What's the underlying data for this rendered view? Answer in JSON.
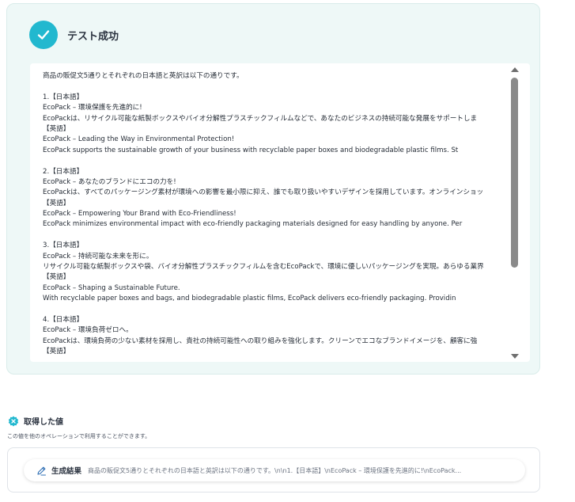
{
  "success": {
    "title": "テスト成功"
  },
  "output": {
    "lines": [
      "商品の販促文5通りとそれぞれの日本語と英訳は以下の通りです。",
      "",
      "1.【日本語】",
      "EcoPack – 環境保護を先進的に!",
      "EcoPackは、リサイクル可能な紙製ボックスやバイオ分解性プラスチックフィルムなどで、あなたのビジネスの持続可能な発展をサポートしま",
      "【英語】",
      "EcoPack – Leading the Way in Environmental Protection!",
      "EcoPack supports the sustainable growth of your business with recyclable paper boxes and biodegradable plastic films. St",
      "",
      "2.【日本語】",
      "EcoPack – あなたのブランドにエコの力を!",
      "EcoPackは、すべてのパッケージング素材が環境への影響を最小限に抑え、誰でも取り扱いやすいデザインを採用しています。オンラインショッ",
      "【英語】",
      "EcoPack – Empowering Your Brand with Eco-Friendliness!",
      "EcoPack minimizes environmental impact with eco-friendly packaging materials designed for easy handling by anyone. Per",
      "",
      "3.【日本語】",
      "EcoPack – 持続可能な未来を形に。",
      "リサイクル可能な紙製ボックスや袋、バイオ分解性プラスチックフィルムを含むEcoPackで、環境に優しいパッケージングを実現。あらゆる業界",
      "【英語】",
      "EcoPack – Shaping a Sustainable Future.",
      "With recyclable paper boxes and bags, and biodegradable plastic films, EcoPack delivers eco-friendly packaging. Providin",
      "",
      "4.【日本語】",
      "EcoPack – 環境負荷ゼロへ。",
      "EcoPackは、環境負荷の少ない素材を採用し、貴社の持続可能性への取り組みを強化します。クリーンでエコなブランドイメージを、顧客に強",
      "【英語】"
    ]
  },
  "acquired": {
    "title": "取得した値",
    "description": "この値を他のオペレーションで利用することができます。",
    "item_label": "生成結果",
    "item_preview": "商品の販促文5通りとそれぞれの日本語と英訳は以下の通りです。\\n\\n1.【日本語】\\nEcoPack – 環境保護を先進的に!\\nEcoPack..."
  },
  "colors": {
    "accent": "#22b8cf",
    "card_bg": "#eef8f7"
  },
  "icons": {
    "success": "check-icon",
    "acquired": "badge-icon",
    "item": "pencil-icon"
  }
}
